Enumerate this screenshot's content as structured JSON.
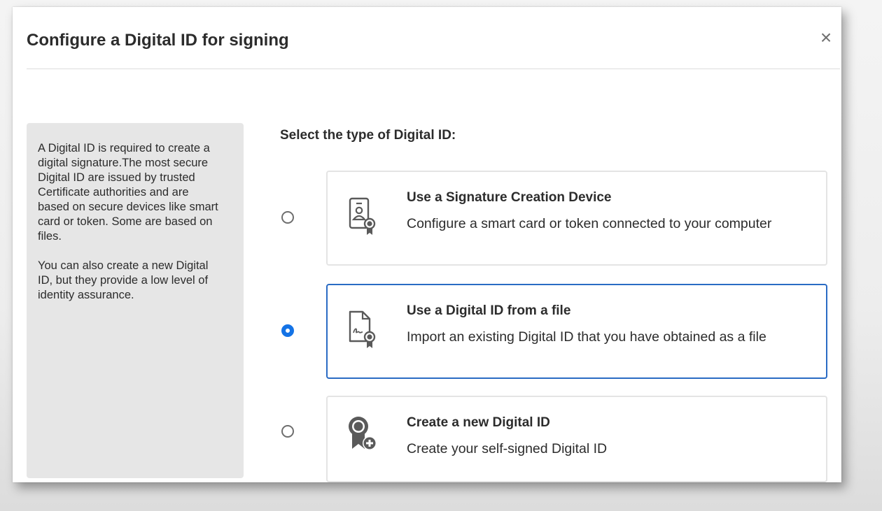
{
  "dialog": {
    "title": "Configure a Digital ID for signing",
    "close_symbol": "×"
  },
  "info": {
    "paragraph1": "A Digital ID is required to create a digital signature.The most secure Digital ID are issued by trusted Certificate authorities and are based on secure devices like smart card or token. Some are based on files.",
    "paragraph2": "You can also create a new Digital ID, but they provide a low level of identity assurance."
  },
  "select_label": "Select the type of Digital ID:",
  "options": [
    {
      "title": "Use a Signature Creation Device",
      "description": "Configure a smart card or token connected to your computer",
      "icon": "id-card-certificate-icon",
      "selected": false
    },
    {
      "title": "Use a Digital ID from a file",
      "description": "Import an existing Digital ID that you have obtained as a file",
      "icon": "signed-file-certificate-icon",
      "selected": true
    },
    {
      "title": "Create a new Digital ID",
      "description": "Create your self-signed Digital ID",
      "icon": "ribbon-add-icon",
      "selected": false
    }
  ],
  "colors": {
    "accent": "#1473e6",
    "selected_border": "#2a6bc4",
    "info_panel_bg": "#e6e6e6",
    "text": "#2c2c2c"
  }
}
